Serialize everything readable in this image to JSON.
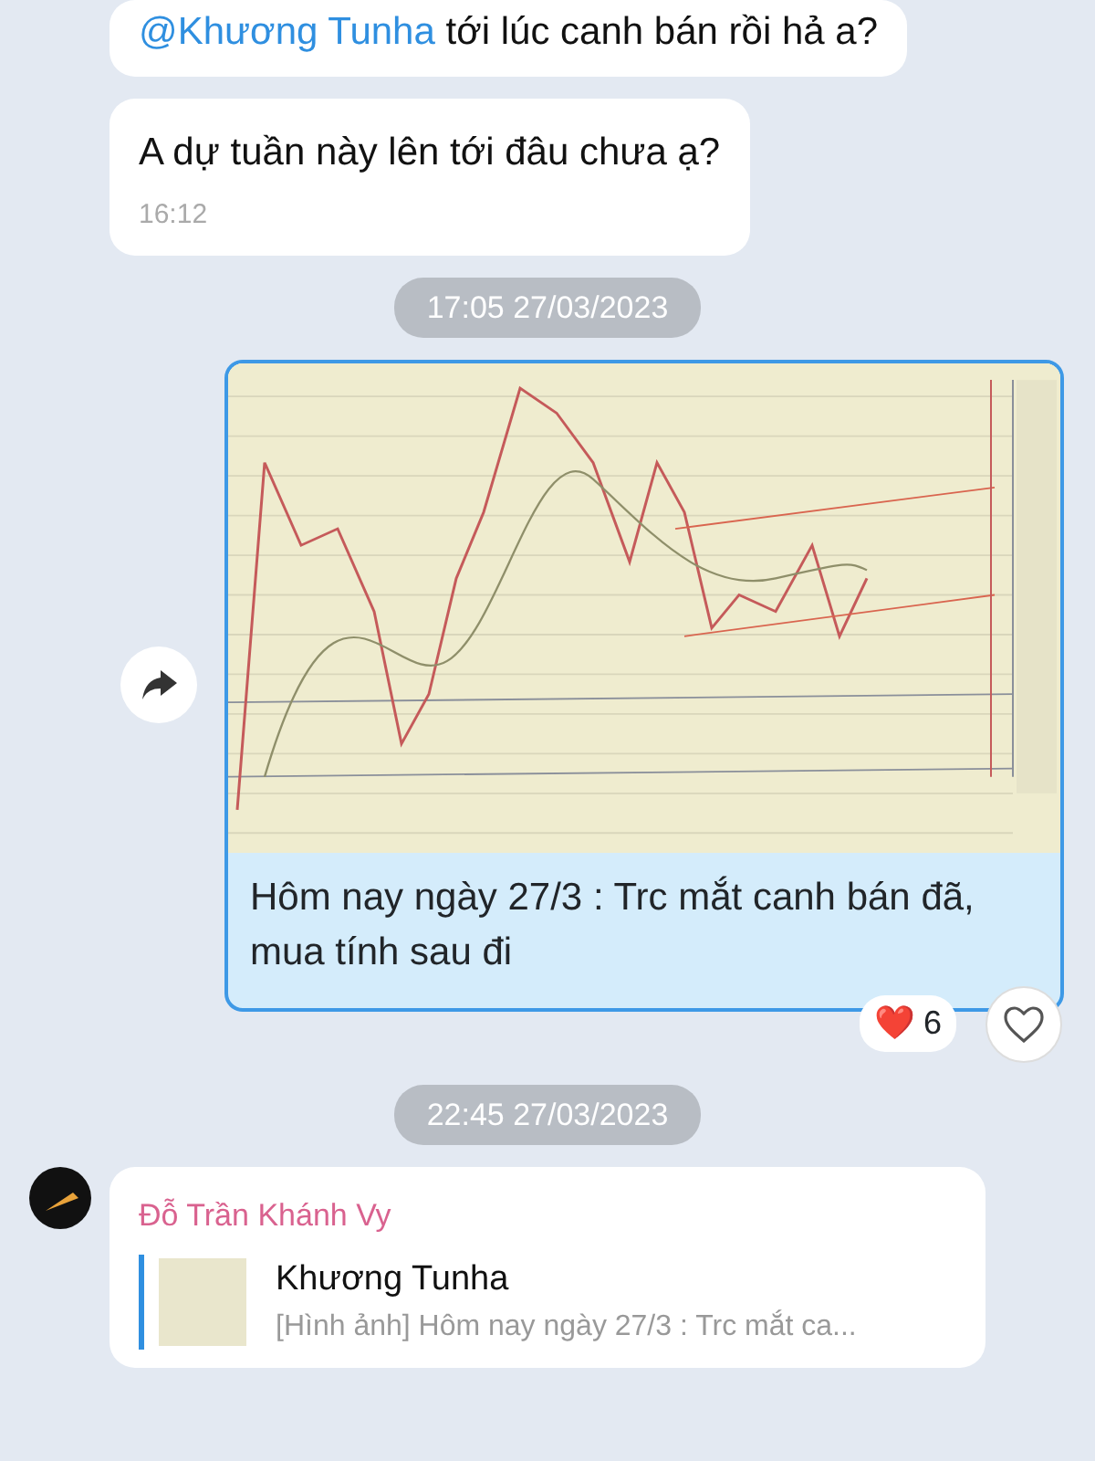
{
  "messages": [
    {
      "kind": "text",
      "mention": "@Khương Tunha",
      "text": " tới lúc canh bán rồi hả a?"
    },
    {
      "kind": "text",
      "text": "A dự tuần này lên tới đâu chưa ạ?",
      "time": "16:12"
    },
    {
      "kind": "date",
      "text": "17:05 27/03/2023"
    },
    {
      "kind": "photo",
      "caption": "Hôm nay ngày 27/3 : Trc mắt canh bán đã, mua tính sau đi",
      "reaction": {
        "emoji": "❤️",
        "count": "6"
      }
    },
    {
      "kind": "date",
      "text": "22:45 27/03/2023"
    },
    {
      "kind": "reply",
      "sender": "Đỗ Trần Khánh Vy",
      "quote_author": "Khương Tunha",
      "quote_text": "[Hình ảnh] Hôm nay ngày 27/3 : Trc mắt ca..."
    }
  ]
}
